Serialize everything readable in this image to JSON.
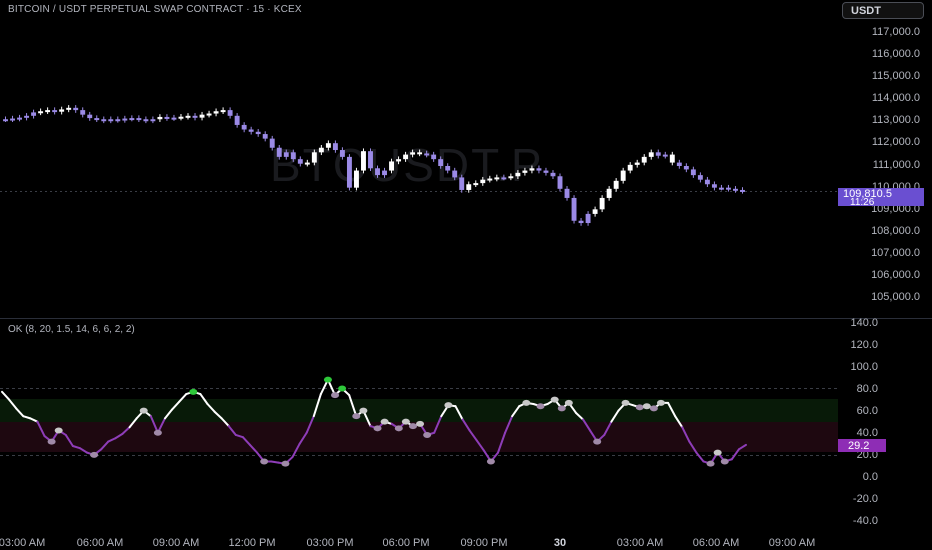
{
  "header": {
    "title": "BITCOIN / USDT PERPETUAL SWAP CONTRACT · 15 · KCEX",
    "currency_button": "USDT",
    "watermark": "BTCUSDT.P"
  },
  "colors": {
    "background": "#000000",
    "candle": "#9b8ae6",
    "candle_up": "#ffffff",
    "price_badge": "#6a4fd1",
    "indicator_line_high": "#ffffff",
    "indicator_line_low": "#8e3db8",
    "indicator_badge": "#8e2db5",
    "green_dot": "#2ec83a"
  },
  "price_axis": {
    "ticks": [
      "117,000.0",
      "116,000.0",
      "115,000.0",
      "114,000.0",
      "113,000.0",
      "112,000.0",
      "111,000.0",
      "110,000.0",
      "109,000.0",
      "108,000.0",
      "107,000.0",
      "106,000.0",
      "105,000.0"
    ]
  },
  "price_badge": {
    "price": "109,810.5",
    "countdown": "11:26"
  },
  "indicator": {
    "label": "OK (8, 20, 1.5, 14, 6, 6, 2, 2)",
    "axis_ticks": [
      "140.0",
      "120.0",
      "100.0",
      "80.0",
      "60.0",
      "40.0",
      "20.0",
      "0.0",
      "-20.0",
      "-40.0"
    ],
    "current_value": "29.2"
  },
  "time_axis": {
    "labels": [
      "03:00 AM",
      "06:00 AM",
      "09:00 AM",
      "12:00 PM",
      "03:00 PM",
      "06:00 PM",
      "09:00 PM",
      "30",
      "03:00 AM",
      "06:00 AM",
      "09:00 AM"
    ]
  },
  "chart_data": [
    {
      "type": "candlestick",
      "ylim": [
        104500,
        117300
      ],
      "close": [
        112950,
        112980,
        113020,
        113100,
        113250,
        113300,
        113350,
        113280,
        113380,
        113450,
        113350,
        113150,
        113000,
        112950,
        112900,
        112950,
        112920,
        112980,
        113000,
        112950,
        112900,
        112950,
        113050,
        113000,
        113020,
        113060,
        113100,
        113020,
        113150,
        113200,
        113300,
        113350,
        113100,
        112700,
        112500,
        112400,
        112300,
        112100,
        111700,
        111300,
        111500,
        111200,
        111000,
        111050,
        111500,
        111700,
        111900,
        111600,
        111300,
        109950,
        110700,
        111550,
        110800,
        110500,
        110700,
        111100,
        111200,
        111400,
        111500,
        111450,
        111400,
        111200,
        110900,
        110700,
        110400,
        109850,
        110100,
        110150,
        110300,
        110350,
        110400,
        110400,
        110450,
        110600,
        110700,
        110800,
        110700,
        110600,
        110450,
        109900,
        109500,
        108500,
        108400,
        108800,
        109000,
        109500,
        109900,
        110250,
        110700,
        110950,
        111050,
        111300,
        111500,
        111350,
        111400,
        111050,
        110900,
        110750,
        110500,
        110300,
        110100,
        109950,
        109950,
        109900,
        109850,
        109810
      ],
      "up_indices": [
        5,
        6,
        8,
        9,
        22,
        25,
        26,
        28,
        29,
        30,
        31,
        43,
        44,
        45,
        46,
        50,
        51,
        55,
        56,
        57,
        58,
        59,
        66,
        67,
        68,
        69,
        70,
        72,
        73,
        74,
        75,
        84,
        85,
        86,
        87,
        88,
        89,
        90,
        91,
        92,
        95
      ]
    },
    {
      "type": "line",
      "name": "OK",
      "ylim": [
        -48,
        142
      ],
      "values": [
        77,
        70,
        62,
        55,
        53,
        50,
        37,
        32,
        42,
        38,
        28,
        26,
        22,
        20,
        25,
        32,
        35,
        39,
        45,
        53,
        60,
        55,
        40,
        53,
        61,
        68,
        75,
        77,
        75,
        66,
        59,
        53,
        46,
        38,
        36,
        29,
        22,
        14,
        14,
        13,
        12,
        18,
        30,
        40,
        55,
        75,
        88,
        74,
        80,
        74,
        55,
        60,
        46,
        44,
        50,
        48,
        44,
        50,
        46,
        48,
        38,
        40,
        55,
        65,
        64,
        52,
        42,
        33,
        24,
        14,
        22,
        40,
        55,
        64,
        67,
        66,
        64,
        66,
        70,
        62,
        67,
        58,
        52,
        42,
        32,
        38,
        50,
        60,
        67,
        65,
        63,
        64,
        62,
        67,
        67,
        55,
        45,
        32,
        22,
        14,
        12,
        22,
        14,
        16,
        25,
        29
      ],
      "highlight_markers_high": [
        27,
        46,
        48
      ],
      "markers_high_count": 9
    }
  ]
}
